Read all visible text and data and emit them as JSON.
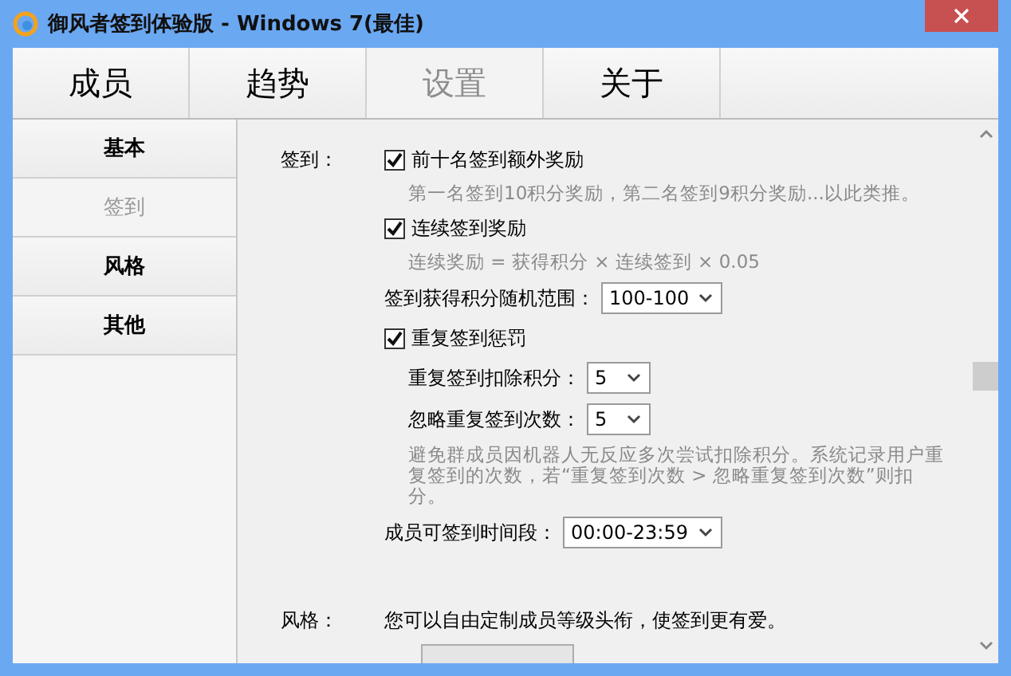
{
  "window": {
    "title": "御风者签到体验版 - Windows 7(最佳)"
  },
  "tabs": [
    {
      "label": "成员",
      "selected": false
    },
    {
      "label": "趋势",
      "selected": false
    },
    {
      "label": "设置",
      "selected": true
    },
    {
      "label": "关于",
      "selected": false
    }
  ],
  "sidebar": {
    "items": [
      {
        "label": "基本",
        "selected": false
      },
      {
        "label": "签到",
        "selected": true
      },
      {
        "label": "风格",
        "selected": false
      },
      {
        "label": "其他",
        "selected": false
      }
    ]
  },
  "sections": [
    {
      "label": "签到：",
      "items": [
        {
          "kind": "checkbox",
          "label": "前十名签到额外奖励",
          "checked": true,
          "children": [
            {
              "kind": "hint",
              "text": "第一名签到10积分奖励，第二名签到9积分奖励...以此类推。"
            }
          ]
        },
        {
          "kind": "checkbox",
          "label": "连续签到奖励",
          "checked": true,
          "children": [
            {
              "kind": "hint",
              "text": "连续奖励 = 获得积分 × 连续签到 × 0.05"
            }
          ]
        },
        {
          "kind": "select",
          "label": "签到获得积分随机范围：",
          "value": "100-100"
        },
        {
          "kind": "checkbox",
          "label": "重复签到惩罚",
          "checked": true,
          "children": [
            {
              "kind": "select",
              "label": "重复签到扣除积分：",
              "value": "5"
            },
            {
              "kind": "select",
              "label": "忽略重复签到次数：",
              "value": "5"
            },
            {
              "kind": "hint",
              "text": "避免群成员因机器人无反应多次尝试扣除积分。系统记录用户重复签到的次数，若“重复签到次数 > 忽略重复签到次数”则扣分。"
            }
          ]
        },
        {
          "kind": "select",
          "label": "成员可签到时间段：",
          "value": "00:00-23:59"
        }
      ]
    },
    {
      "label": "风格：",
      "items": [
        {
          "kind": "text",
          "text": "您可以自由定制成员等级头衔，使签到更有爱。"
        },
        {
          "kind": "button"
        }
      ]
    }
  ]
}
